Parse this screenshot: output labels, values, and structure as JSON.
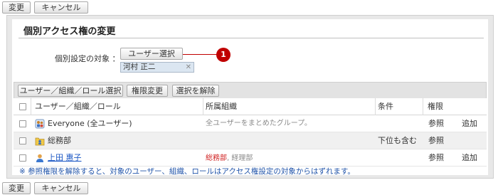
{
  "top_buttons": {
    "change": "変更",
    "cancel": "キャンセル"
  },
  "bottom_buttons": {
    "change": "変更",
    "cancel": "キャンセル"
  },
  "panel": {
    "title": "個別アクセス権の変更",
    "target_label": "個別設定の対象 ：",
    "user_select_button": "ユーザー選択",
    "selected_target": "河村 正二",
    "remove_glyph": "✕",
    "callout_number": "1"
  },
  "toolbar": {
    "select_button": "ユーザー／組織／ロール選択",
    "permission_change_button": "権限変更",
    "deselect_button": "選択を解除"
  },
  "table": {
    "columns": [
      "ユーザー／組織／ロール",
      "所属組織",
      "条件",
      "権限"
    ],
    "rows": [
      {
        "name": "Everyone (全ユーザー)",
        "org": "全ユーザーをまとめたグループ。",
        "condition": "",
        "perm1": "参照",
        "perm2": "追加",
        "icon": "everyone-group-icon",
        "style": "white"
      },
      {
        "name": "総務部",
        "org": "",
        "condition": "下位も含む",
        "perm1": "参照",
        "perm2": "",
        "icon": "organization-icon",
        "style": "gray"
      },
      {
        "name": "上田 惠子",
        "org_primary": "総務部",
        "org_rest": ", 経理部",
        "condition": "",
        "perm1": "参照",
        "perm2": "追加",
        "icon": "user-icon",
        "style": "white"
      }
    ]
  },
  "note": "※ 参照権限を解除すると、対象のユーザー、組織、ロールはアクセス権設定の対象からはずれます。",
  "colors": {
    "callout": "#c00000",
    "link": "#1a56c4",
    "note": "#2255aa",
    "org_red": "#d02020"
  }
}
